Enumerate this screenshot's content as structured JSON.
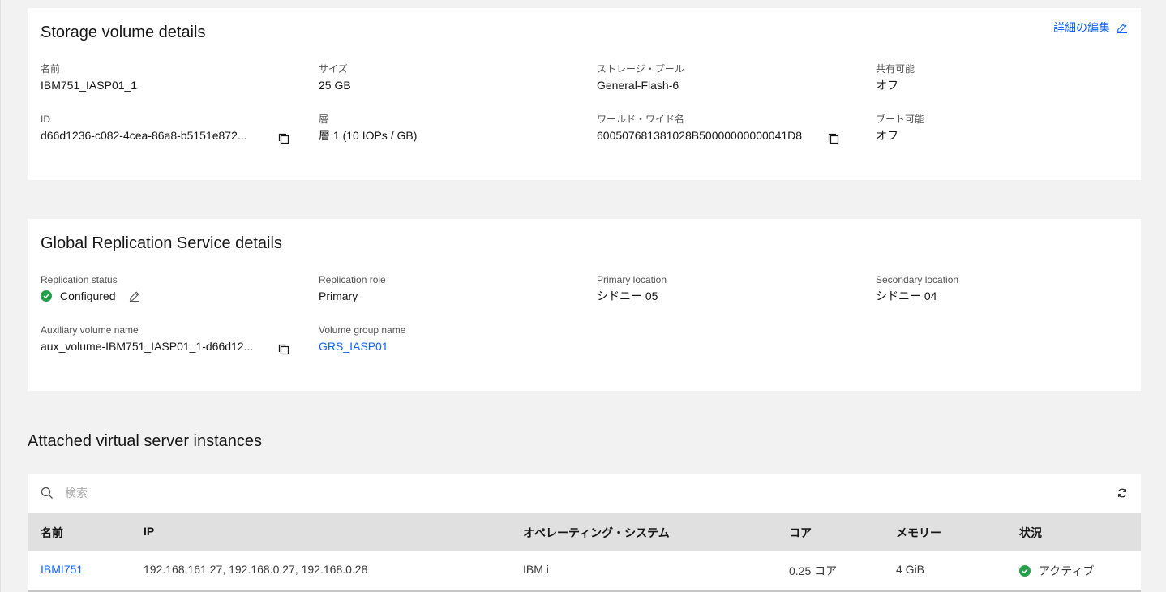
{
  "storage": {
    "title": "Storage volume details",
    "edit_label": "詳細の編集",
    "fields": {
      "name": {
        "label": "名前",
        "value": "IBM751_IASP01_1"
      },
      "size": {
        "label": "サイズ",
        "value": "25 GB"
      },
      "pool": {
        "label": "ストレージ・プール",
        "value": "General-Flash-6"
      },
      "shareable": {
        "label": "共有可能",
        "value": "オフ"
      },
      "id": {
        "label": "ID",
        "value": "d66d1236-c082-4cea-86a8-b5151e872..."
      },
      "tier": {
        "label": "層",
        "value": "層 1 (10 IOPs / GB)"
      },
      "wwn": {
        "label": "ワールド・ワイド名",
        "value": "600507681381028B50000000000041D8"
      },
      "bootable": {
        "label": "ブート可能",
        "value": "オフ"
      }
    }
  },
  "grs": {
    "title": "Global Replication Service details",
    "fields": {
      "status": {
        "label": "Replication status",
        "value": "Configured"
      },
      "role": {
        "label": "Replication role",
        "value": "Primary"
      },
      "primary": {
        "label": "Primary location",
        "value": "シドニー 05"
      },
      "secondary": {
        "label": "Secondary location",
        "value": "シドニー 04"
      },
      "aux": {
        "label": "Auxiliary volume name",
        "value": "aux_volume-IBM751_IASP01_1-d66d12..."
      },
      "group": {
        "label": "Volume group name",
        "value": "GRS_IASP01"
      }
    }
  },
  "instances": {
    "title": "Attached virtual server instances",
    "search_placeholder": "検索",
    "columns": [
      "名前",
      "IP",
      "オペレーティング・システム",
      "コア",
      "メモリー",
      "状況"
    ],
    "rows": [
      {
        "name": "IBMI751",
        "ip": "192.168.161.27, 192.168.0.27, 192.168.0.28",
        "os": "IBM i",
        "cores": "0.25 コア",
        "memory": "4 GiB",
        "status": "アクティブ"
      }
    ]
  },
  "colors": {
    "link": "#0f62fe",
    "success": "#24a148",
    "header_bg": "#e0e0e0",
    "page_bg": "#f2f2f2"
  },
  "icons": {
    "copy": "copy-icon",
    "edit": "pencil-icon",
    "search": "search-icon",
    "refresh": "refresh-icon",
    "status": "checkmark-filled-icon"
  }
}
